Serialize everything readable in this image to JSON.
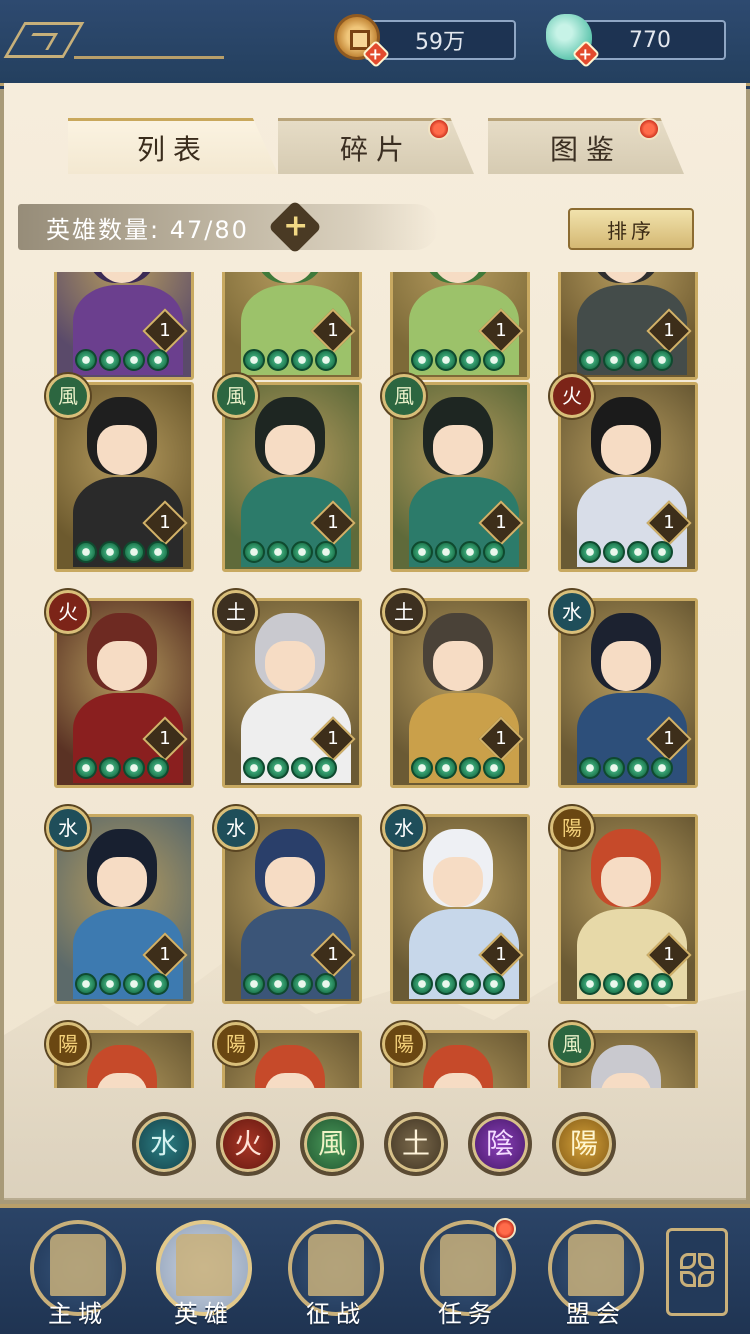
{
  "topbar": {
    "coins": {
      "icon": "copper-coin-icon",
      "value": "59万"
    },
    "jade": {
      "icon": "jade-icon",
      "value": "770"
    }
  },
  "tabs": [
    {
      "label": "列表",
      "active": true,
      "badge": false
    },
    {
      "label": "碎片",
      "active": false,
      "badge": true
    },
    {
      "label": "图鉴",
      "active": false,
      "badge": true
    }
  ],
  "hero_count": {
    "label": "英雄数量: 47/80",
    "add": "+"
  },
  "sort_label": "排序",
  "elements": {
    "wind": "風",
    "fire": "火",
    "earth": "土",
    "water": "水",
    "yin": "陰",
    "yang": "陽"
  },
  "heroes": [
    {
      "element": "",
      "level": "1",
      "stars": 4,
      "palette": "purple"
    },
    {
      "element": "",
      "level": "1",
      "stars": 4,
      "palette": "leaf"
    },
    {
      "element": "",
      "level": "1",
      "stars": 4,
      "palette": "leaf"
    },
    {
      "element": "",
      "level": "1",
      "stars": 4,
      "palette": "dark"
    },
    {
      "element": "wind",
      "level": "1",
      "stars": 4,
      "palette": "ninja"
    },
    {
      "element": "wind",
      "level": "1",
      "stars": 4,
      "palette": "teal"
    },
    {
      "element": "wind",
      "level": "1",
      "stars": 4,
      "palette": "teal"
    },
    {
      "element": "fire",
      "level": "1",
      "stars": 4,
      "palette": "white"
    },
    {
      "element": "fire",
      "level": "1",
      "stars": 4,
      "palette": "crimson"
    },
    {
      "element": "earth",
      "level": "1",
      "stars": 4,
      "palette": "silver"
    },
    {
      "element": "earth",
      "level": "1",
      "stars": 4,
      "palette": "gold"
    },
    {
      "element": "water",
      "level": "1",
      "stars": 4,
      "palette": "navy"
    },
    {
      "element": "water",
      "level": "1",
      "stars": 4,
      "palette": "blue"
    },
    {
      "element": "water",
      "level": "1",
      "stars": 4,
      "palette": "hat"
    },
    {
      "element": "water",
      "level": "1",
      "stars": 4,
      "palette": "pale"
    },
    {
      "element": "yang",
      "level": "1",
      "stars": 4,
      "palette": "redhair"
    },
    {
      "element": "yang",
      "level": "",
      "stars": 0,
      "palette": "redhair"
    },
    {
      "element": "yang",
      "level": "",
      "stars": 0,
      "palette": "redhair"
    },
    {
      "element": "yang",
      "level": "",
      "stars": 0,
      "palette": "redhair"
    },
    {
      "element": "wind",
      "level": "",
      "stars": 0,
      "palette": "silver"
    }
  ],
  "filters": [
    {
      "key": "water",
      "label": "水"
    },
    {
      "key": "fire",
      "label": "火"
    },
    {
      "key": "wind",
      "label": "風"
    },
    {
      "key": "earth",
      "label": "土"
    },
    {
      "key": "yin",
      "label": "陰"
    },
    {
      "key": "yang",
      "label": "陽"
    }
  ],
  "nav": [
    {
      "label": "主城",
      "icon": "city-icon",
      "active": false,
      "badge": false
    },
    {
      "label": "英雄",
      "icon": "hero-icon",
      "active": true,
      "badge": false
    },
    {
      "label": "征战",
      "icon": "battle-icon",
      "active": false,
      "badge": false
    },
    {
      "label": "任务",
      "icon": "task-icon",
      "active": false,
      "badge": true
    },
    {
      "label": "盟会",
      "icon": "guild-icon",
      "active": false,
      "badge": false
    }
  ],
  "more_icon": "more-flower-icon"
}
